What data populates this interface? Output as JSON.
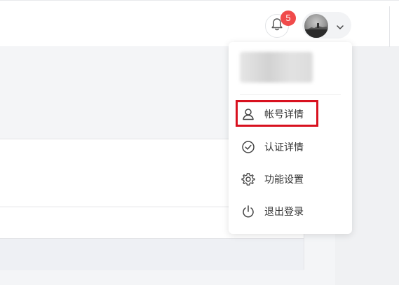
{
  "header": {
    "notification_count": "5"
  },
  "dropdown": {
    "items": [
      {
        "label": "帐号详情",
        "icon": "user-icon"
      },
      {
        "label": "认证详情",
        "icon": "check-circle-icon"
      },
      {
        "label": "功能设置",
        "icon": "gear-icon"
      },
      {
        "label": "退出登录",
        "icon": "power-icon"
      }
    ]
  },
  "colors": {
    "badge": "#f04b4b",
    "highlight": "#d8111f"
  }
}
